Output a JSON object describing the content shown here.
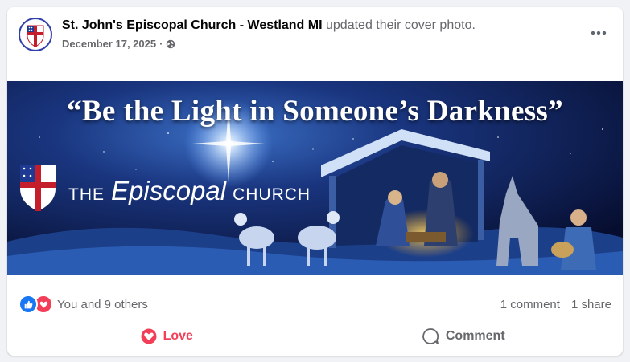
{
  "post": {
    "page_name": "St. John's Episcopal Church - Westland MI",
    "action_text": "updated their cover photo.",
    "date": "December 17, 2025",
    "separator": "·",
    "privacy_icon": "globe-icon",
    "more_icon": "more-options-icon"
  },
  "banner": {
    "headline": "“Be the Light in Someone’s Darkness”",
    "brand_the": "THE",
    "brand_episcopal": "Episcopal",
    "brand_church": "CHURCH"
  },
  "stats": {
    "reactions_text": "You and 9 others",
    "comments": "1 comment",
    "shares": "1 share",
    "reaction_icons": [
      "like-icon",
      "love-icon"
    ]
  },
  "actions": {
    "love_label": "Love",
    "comment_label": "Comment"
  },
  "colors": {
    "like": "#1877f2",
    "love": "#f33e58",
    "banner_sky": "#0d1a4d",
    "secondary_text": "#65676b"
  }
}
